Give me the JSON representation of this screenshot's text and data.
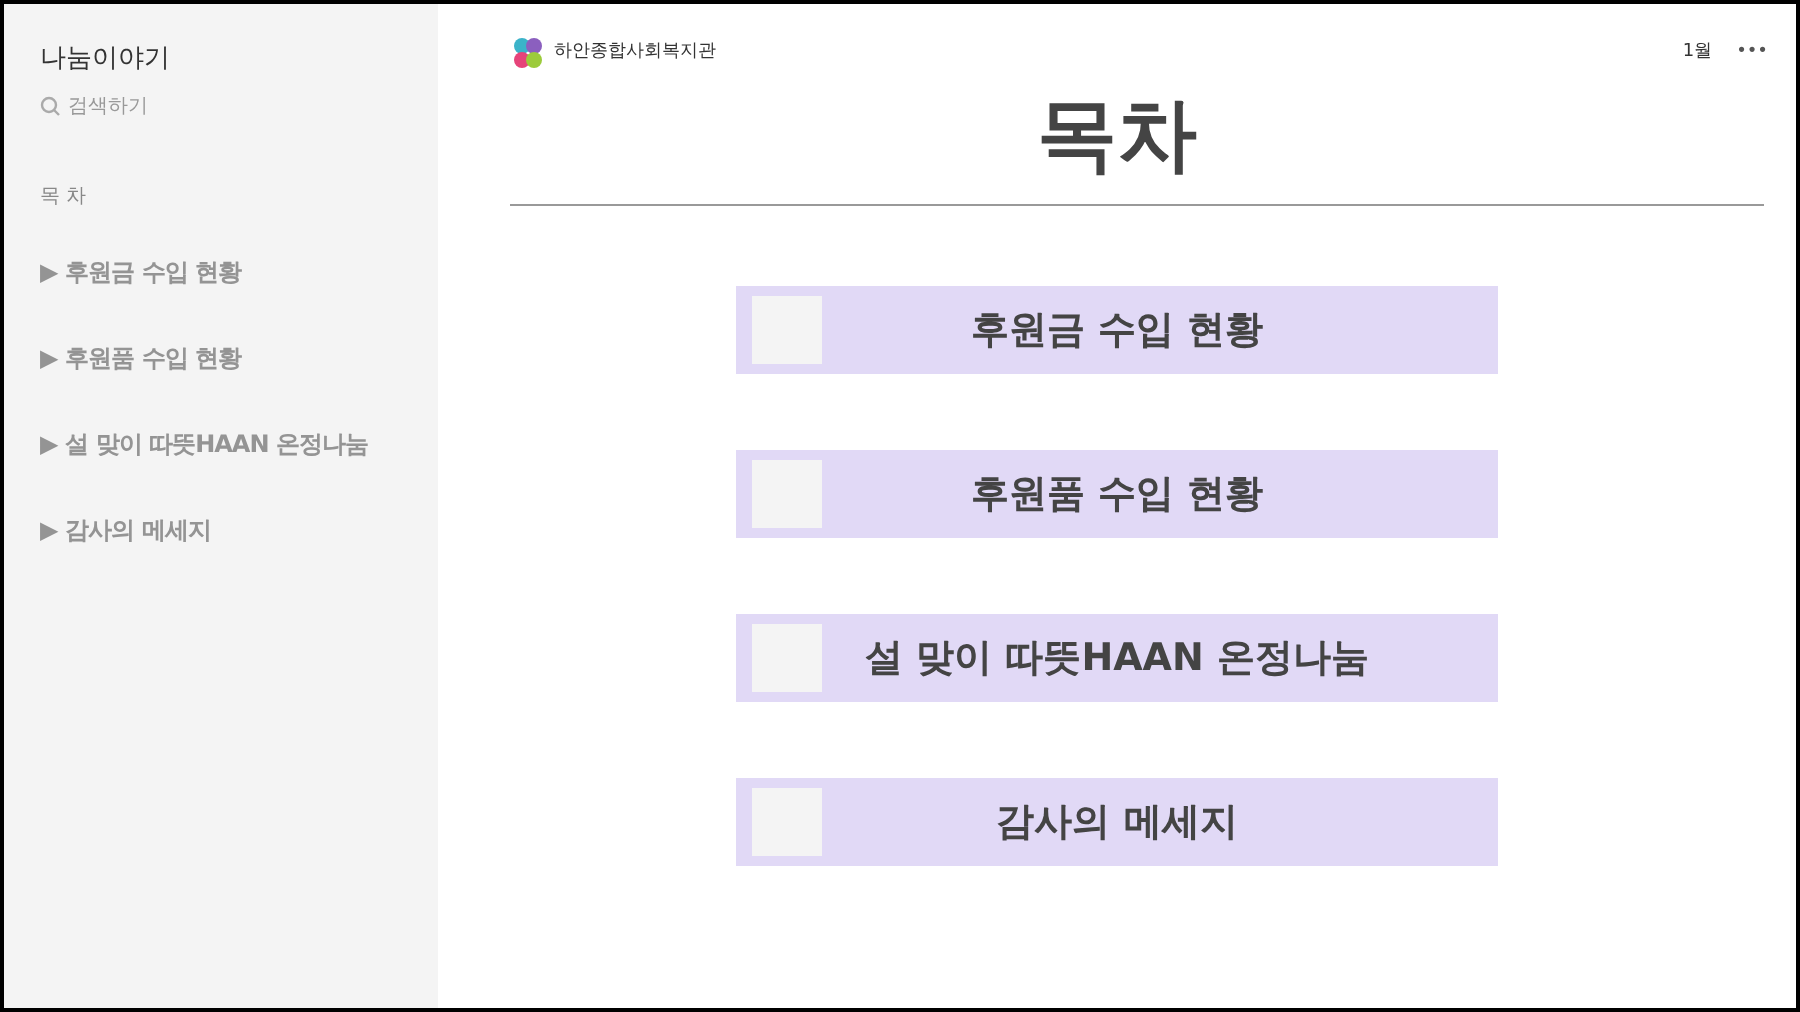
{
  "sidebar": {
    "title": "나눔이야기",
    "search": {
      "placeholder": "검색하기"
    },
    "section": "목 차",
    "items": [
      {
        "marker": "▶",
        "label": "후원금 수입 현황"
      },
      {
        "marker": "▶",
        "label": "후원품 수입 현황"
      },
      {
        "marker": "▶",
        "label": "설 맞이 따뜻HAAN 온정나눔"
      },
      {
        "marker": "▶",
        "label": "감사의 메세지"
      }
    ]
  },
  "header": {
    "organization": "하안종합사회복지관",
    "month": "1월",
    "more": "•••"
  },
  "page": {
    "title": "목차",
    "entries": [
      {
        "label": "후원금 수입 현황"
      },
      {
        "label": "후원품 수입 현황"
      },
      {
        "label": "설 맞이 따뜻HAAN 온정나눔"
      },
      {
        "label": "감사의 메세지"
      }
    ]
  }
}
